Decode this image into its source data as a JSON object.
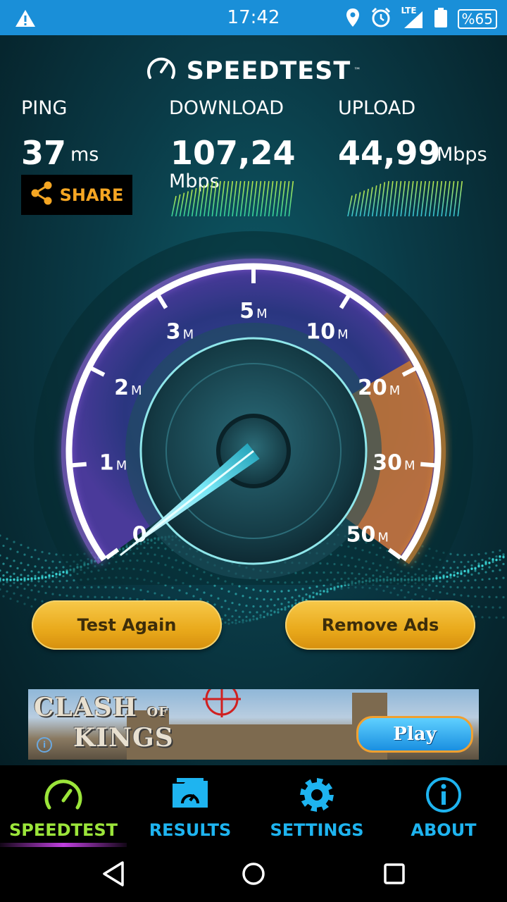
{
  "status_bar": {
    "time": "17:42",
    "network": "LTE",
    "battery": "%65",
    "color": "#1a8fd8"
  },
  "app": {
    "brand": "SPEEDTEST",
    "trademark": "™"
  },
  "stats": {
    "ping": {
      "label": "PING",
      "value": "37",
      "unit": "ms"
    },
    "download": {
      "label": "DOWNLOAD",
      "value": "107,24",
      "unit": "Mbps"
    },
    "upload": {
      "label": "UPLOAD",
      "value": "44,99",
      "unit": "Mbps"
    }
  },
  "share": {
    "label": "SHARE",
    "color": "#f5a623"
  },
  "gauge": {
    "ticks": [
      {
        "num": "0",
        "unit": ""
      },
      {
        "num": "1",
        "unit": "M"
      },
      {
        "num": "2",
        "unit": "M"
      },
      {
        "num": "3",
        "unit": "M"
      },
      {
        "num": "5",
        "unit": "M"
      },
      {
        "num": "10",
        "unit": "M"
      },
      {
        "num": "20",
        "unit": "M"
      },
      {
        "num": "30",
        "unit": "M"
      },
      {
        "num": "50",
        "unit": "M"
      }
    ]
  },
  "buttons": {
    "test_again": "Test Again",
    "remove_ads": "Remove Ads"
  },
  "ad": {
    "title_1": "CLASH",
    "title_of": "OF",
    "title_2": "KINGS",
    "cta": "Play",
    "info": "i"
  },
  "bottom_nav": {
    "items": [
      {
        "label": "SPEEDTEST",
        "color": "#9be53a",
        "active": true
      },
      {
        "label": "RESULTS",
        "color": "#1eb4f0"
      },
      {
        "label": "SETTINGS",
        "color": "#1eb4f0"
      },
      {
        "label": "ABOUT",
        "color": "#1eb4f0"
      }
    ]
  }
}
